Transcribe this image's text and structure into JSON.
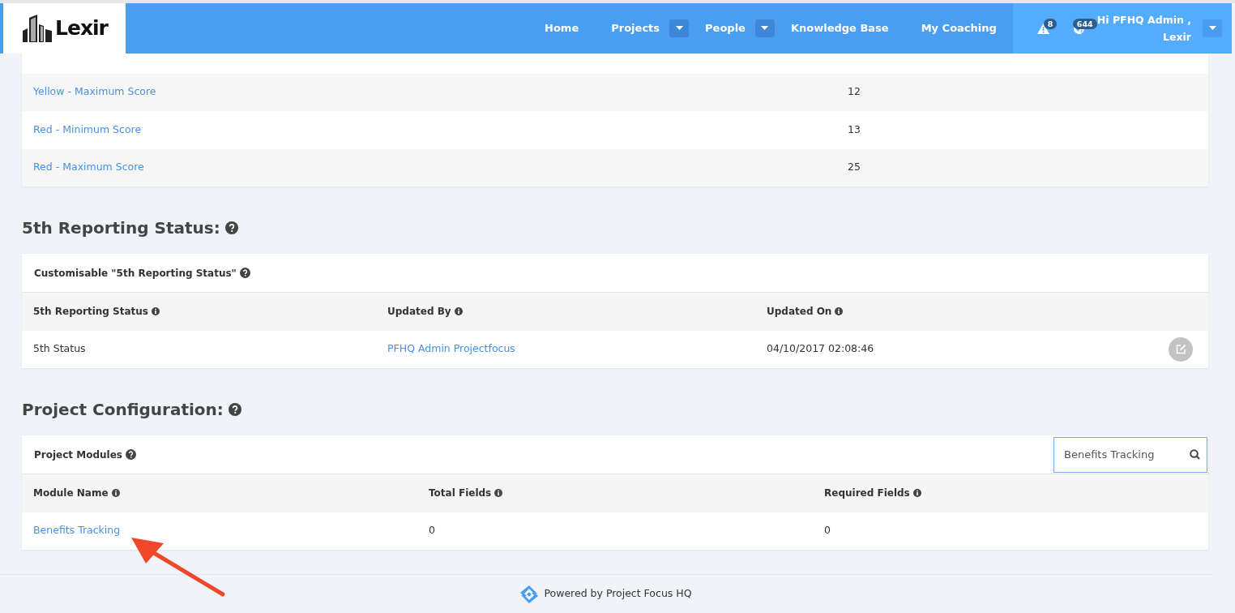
{
  "navbar": {
    "logo": "Lexir",
    "items": [
      {
        "label": "Home",
        "dropdown": false
      },
      {
        "label": "Projects",
        "dropdown": true
      },
      {
        "label": "People",
        "dropdown": true
      },
      {
        "label": "Knowledge Base",
        "dropdown": false
      },
      {
        "label": "My Coaching",
        "dropdown": false
      }
    ],
    "alerts": {
      "count": "8"
    },
    "notifications": {
      "count": "644"
    },
    "user": {
      "greeting": "Hi PFHQ Admin ,",
      "company": "Lexir"
    }
  },
  "score_table": {
    "rows": [
      {
        "label": "Yellow - Maximum Score",
        "value": "12"
      },
      {
        "label": "Red - Minimum Score",
        "value": "13"
      },
      {
        "label": "Red - Maximum Score",
        "value": "25"
      }
    ]
  },
  "sections": [
    {
      "heading": "5th Reporting Status:",
      "card_title": "Customisable \"5th Reporting Status\"",
      "columns": [
        "5th Reporting Status",
        "Updated By",
        "Updated On"
      ],
      "rows": [
        {
          "cells": [
            {
              "text": "5th Status",
              "kind": "text"
            },
            {
              "text": "PFHQ Admin Projectfocus",
              "kind": "link"
            },
            {
              "text": "04/10/2017 02:08:46",
              "kind": "text"
            }
          ],
          "editable": true
        }
      ]
    },
    {
      "heading": "Project Configuration:",
      "card_title": "Project Modules",
      "search": {
        "value": "Benefits Tracking"
      },
      "columns": [
        "Module Name",
        "Total Fields",
        "Required Fields"
      ],
      "rows": [
        {
          "cells": [
            {
              "text": "Benefits Tracking",
              "kind": "link"
            },
            {
              "text": "0",
              "kind": "text"
            },
            {
              "text": "0",
              "kind": "text"
            }
          ]
        }
      ]
    }
  ],
  "footer": {
    "text": "Powered by Project Focus HQ"
  },
  "annotation": {
    "kind": "arrow",
    "color": "#f0462a"
  }
}
